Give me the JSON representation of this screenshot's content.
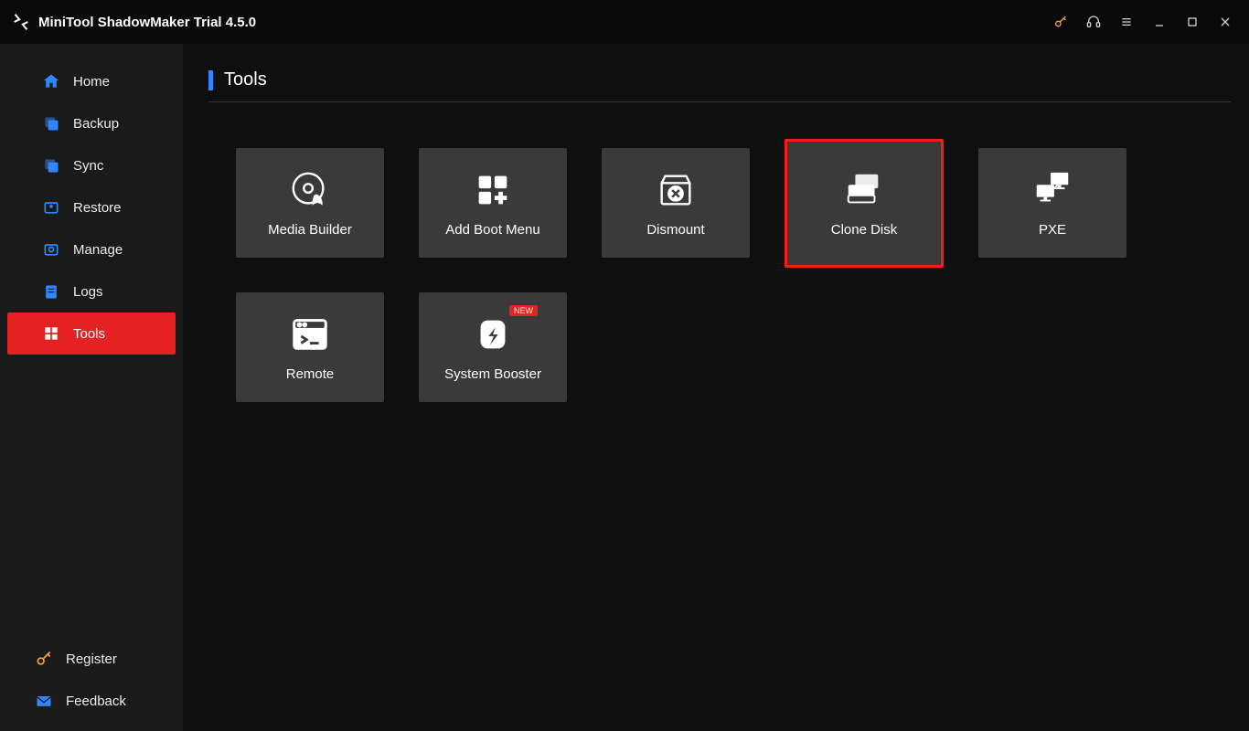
{
  "app": {
    "title": "MiniTool ShadowMaker Trial 4.5.0"
  },
  "sidebar": {
    "items": [
      {
        "label": "Home"
      },
      {
        "label": "Backup"
      },
      {
        "label": "Sync"
      },
      {
        "label": "Restore"
      },
      {
        "label": "Manage"
      },
      {
        "label": "Logs"
      },
      {
        "label": "Tools"
      }
    ],
    "footer": {
      "register": "Register",
      "feedback": "Feedback"
    }
  },
  "page": {
    "title": "Tools"
  },
  "cards": {
    "media_builder": "Media Builder",
    "add_boot_menu": "Add Boot Menu",
    "dismount": "Dismount",
    "clone_disk": "Clone Disk",
    "pxe": "PXE",
    "remote": "Remote",
    "system_booster": "System Booster",
    "new_badge": "NEW"
  }
}
